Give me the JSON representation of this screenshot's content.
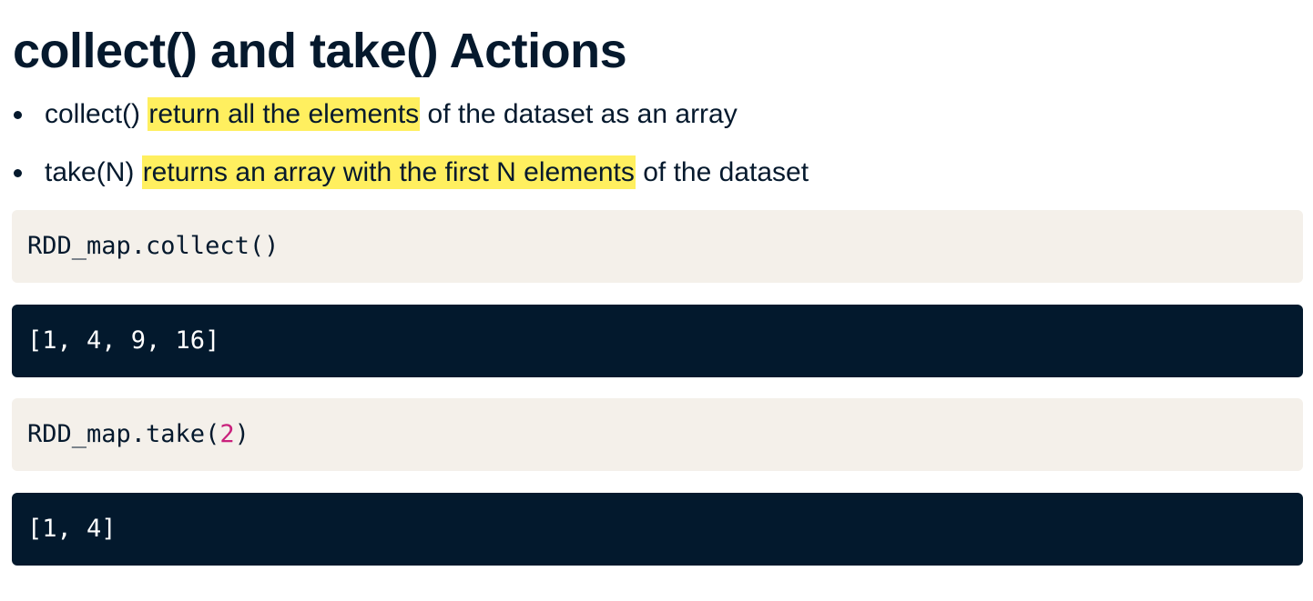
{
  "title": "collect() and take() Actions",
  "bullets": [
    {
      "prefix": "collect() ",
      "highlight": "return all the elements",
      "suffix": " of the dataset as an array"
    },
    {
      "prefix": "take(N) ",
      "highlight": "returns an array with the first N elements",
      "suffix": " of the dataset"
    }
  ],
  "code_blocks": [
    {
      "kind": "input",
      "text": "RDD_map.collect()"
    },
    {
      "kind": "output",
      "text": "[1, 4, 9, 16]"
    },
    {
      "kind": "input",
      "text_before": "RDD_map.take(",
      "number": "2",
      "text_after": ")"
    },
    {
      "kind": "output",
      "text": "[1, 4]"
    }
  ],
  "colors": {
    "text": "#05192d",
    "highlight": "#ffef5f",
    "input_background": "#f4f0ea",
    "output_background": "#03192d",
    "number_literal": "#c9217c"
  }
}
